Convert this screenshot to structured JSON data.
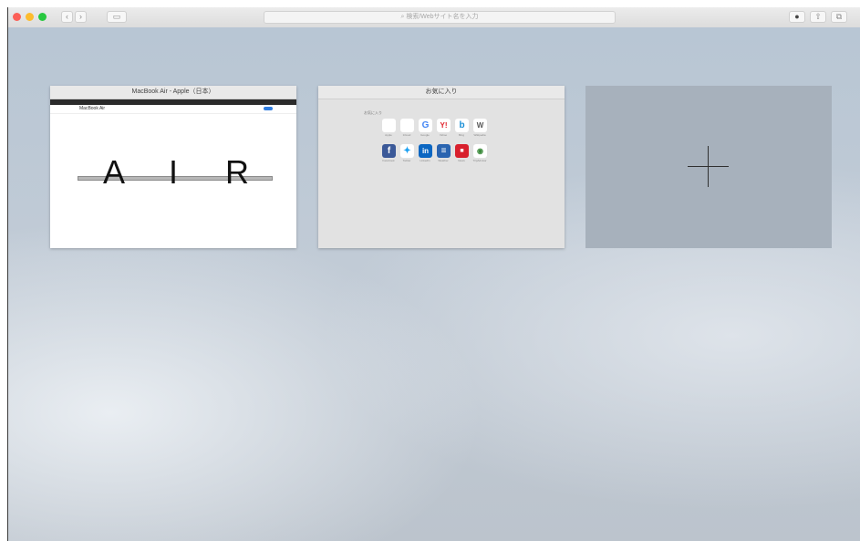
{
  "browser": {
    "address_placeholder": "検索/Webサイト名を入力",
    "icons": [
      "close-icon",
      "minimize-icon",
      "zoom-icon",
      "back-icon",
      "forward-icon",
      "sidebar-icon",
      "search-icon",
      "download-icon",
      "share-icon",
      "tabs-icon"
    ]
  },
  "top_sites": [
    {
      "title": "MacBook Air - Apple（日本）",
      "subnav": "MacBook Air",
      "hero_letters": [
        "A",
        "I",
        "R"
      ]
    },
    {
      "title": "お気に入り",
      "favorites_label": "お気に入り",
      "favorites": [
        {
          "icon": "apple-icon",
          "glyph": "",
          "caption": "Apple"
        },
        {
          "icon": "apple-icon",
          "glyph": "",
          "caption": "iCloud"
        },
        {
          "icon": "google-icon",
          "glyph": "G",
          "caption": "Google"
        },
        {
          "icon": "yahoo-icon",
          "glyph": "Y!",
          "caption": "Yahoo"
        },
        {
          "icon": "bing-icon",
          "glyph": "b",
          "caption": "Bing"
        },
        {
          "icon": "wikipedia-icon",
          "glyph": "W",
          "caption": "Wikipedia"
        },
        {
          "icon": "facebook-icon",
          "glyph": "f",
          "caption": "Facebook"
        },
        {
          "icon": "twitter-icon",
          "glyph": "✦",
          "caption": "Twitter"
        },
        {
          "icon": "linkedin-icon",
          "glyph": "in",
          "caption": "LinkedIn"
        },
        {
          "icon": "weather-icon",
          "glyph": "≡",
          "caption": "Weather"
        },
        {
          "icon": "news-icon",
          "glyph": "■",
          "caption": "News"
        },
        {
          "icon": "tripadvisor-icon",
          "glyph": "◉",
          "caption": "TripAdvisor"
        }
      ]
    },
    {
      "title": "",
      "add_icon": "plus-icon"
    }
  ],
  "colors": {
    "close": "#fc5f57",
    "minimize": "#fdbc2e",
    "zoom": "#28c840",
    "background": "#bcc6d1"
  }
}
